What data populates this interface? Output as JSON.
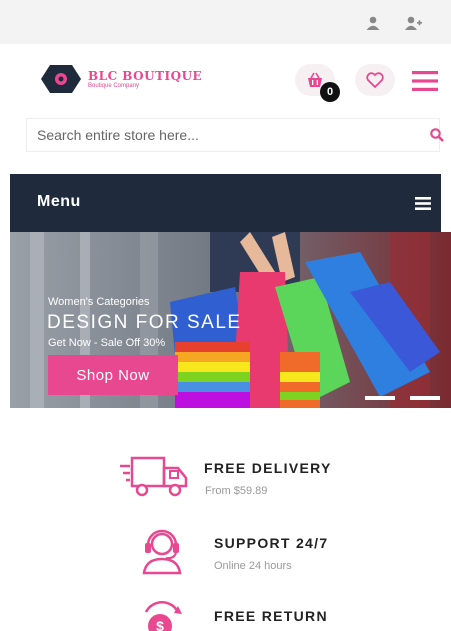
{
  "top_bar": {
    "icons": [
      "user-icon",
      "add-user-icon"
    ]
  },
  "brand": {
    "name": "BLC BOUTIQUE",
    "tagline": "Boutique Company"
  },
  "header": {
    "cart_count": "0",
    "icons": [
      "basket-icon",
      "heart-icon",
      "hamburger-icon"
    ]
  },
  "search": {
    "placeholder": "Search entire store here...",
    "value": ""
  },
  "menu": {
    "label": "Menu"
  },
  "hero": {
    "subtitle": "Women's Categories",
    "title": "DESIGN FOR SALE",
    "offer": "Get Now - Sale Off 30%",
    "button_label": "Shop Now"
  },
  "features": [
    {
      "title": "FREE DELIVERY",
      "subtitle": "From $59.89",
      "icon": "delivery-truck-icon"
    },
    {
      "title": "SUPPORT 24/7",
      "subtitle": "Online 24 hours",
      "icon": "headset-icon"
    },
    {
      "title": "FREE RETURN",
      "subtitle": "",
      "icon": "return-money-icon"
    }
  ],
  "colors": {
    "accent": "#e8488f",
    "menu_bg": "#1f2b3d",
    "topbar_bg": "#f3f3f3"
  }
}
